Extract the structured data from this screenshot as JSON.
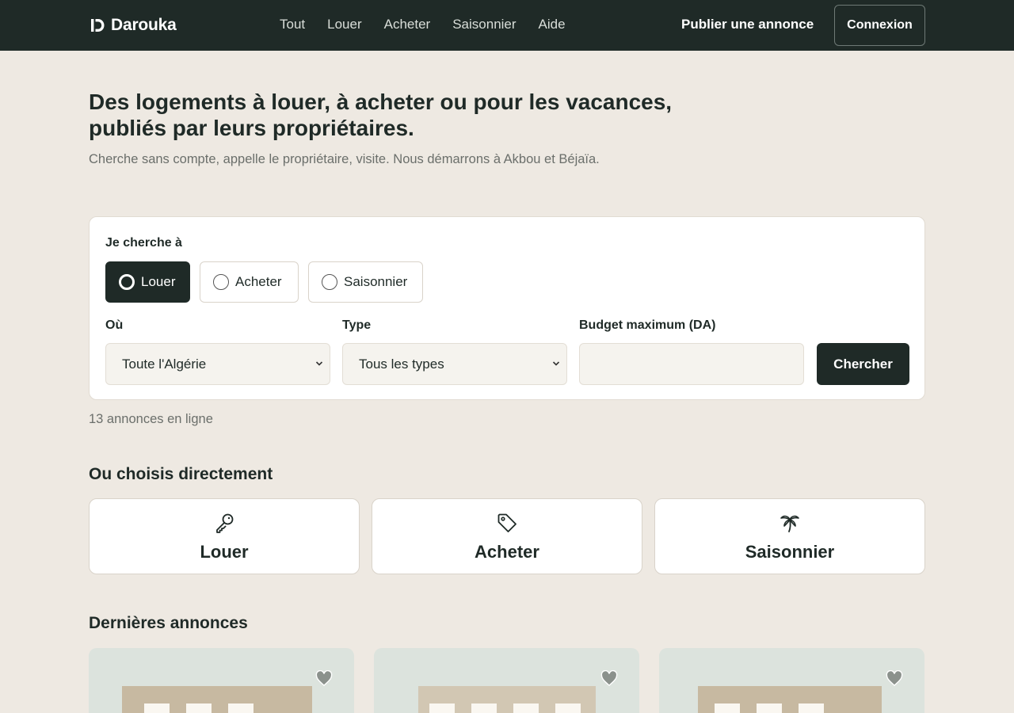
{
  "nav": {
    "brand": "Darouka",
    "links": [
      "Tout",
      "Louer",
      "Acheter",
      "Saisonnier",
      "Aide"
    ],
    "publish": "Publier une annonce",
    "login": "Connexion"
  },
  "hero": {
    "title_line1": "Des logements à louer, à acheter ou pour les vacances,",
    "title_line2": "publiés par leurs propriétaires.",
    "subtitle": "Cherche sans compte, appelle le propriétaire, visite. Nous démarrons à Akbou et Béjaïa."
  },
  "search": {
    "mode_label": "Je cherche à",
    "modes": [
      {
        "label": "Louer",
        "selected": true
      },
      {
        "label": "Acheter",
        "selected": false
      },
      {
        "label": "Saisonnier",
        "selected": false
      }
    ],
    "where_label": "Où",
    "where_value": "Toute l'Algérie",
    "type_label": "Type",
    "type_value": "Tous les types",
    "budget_label": "Budget maximum (DA)",
    "budget_value": "",
    "submit": "Chercher"
  },
  "count_text": "13 annonces en ligne",
  "categories": {
    "title": "Ou choisis directement",
    "items": [
      {
        "label": "Louer",
        "icon": "key-icon"
      },
      {
        "label": "Acheter",
        "icon": "tag-icon"
      },
      {
        "label": "Saisonnier",
        "icon": "palm-tree-icon"
      }
    ]
  },
  "latest": {
    "title": "Dernières annonces"
  },
  "colors": {
    "page_bg": "#EEE9E2",
    "dark": "#1F2A27",
    "muted_text": "#6B6F6B",
    "card_image_bg": "#DCE3DD",
    "building": "#C7B9A1"
  }
}
